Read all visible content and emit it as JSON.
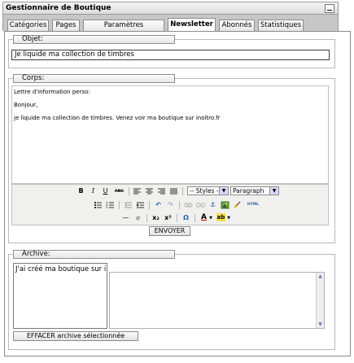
{
  "window": {
    "title": "Gestionnaire de Boutique"
  },
  "tabs": [
    {
      "label": "Catégories"
    },
    {
      "label": "Pages"
    },
    {
      "label": "Paramètres d'Affichage"
    },
    {
      "label": "Newsletter"
    },
    {
      "label": "Abonnés"
    },
    {
      "label": "Statistiques"
    }
  ],
  "active_tab": "Newsletter",
  "objet": {
    "legend": "Objet:",
    "value": "Je liquide ma collection de timbres"
  },
  "corps": {
    "legend": "Corps:",
    "lines": [
      "Lettre d'information perso:",
      "Bonjour,",
      "je liquide ma collection de timbres. Venez voir ma boutique sur inoltro.fr"
    ]
  },
  "toolbar": {
    "row1": [
      "B",
      "I",
      "U",
      "ABC"
    ],
    "styles_select": "-- Styles --",
    "format_select": "Paragraph",
    "row3": [
      "—",
      "⌀",
      "x₂",
      "x²",
      "Ω",
      "A",
      "ab"
    ],
    "html_label": "HTML"
  },
  "send_button": "ENVOYER",
  "archive": {
    "legend": "Archive:",
    "items": [
      "J'ai créé ma boutique sur ir"
    ],
    "delete_button": "EFFACER archive sélectionnée"
  },
  "colors": {
    "tab_bar": "#c7c7c7",
    "border": "#8a8a8a",
    "select_arrow": "#d8d8ff"
  }
}
